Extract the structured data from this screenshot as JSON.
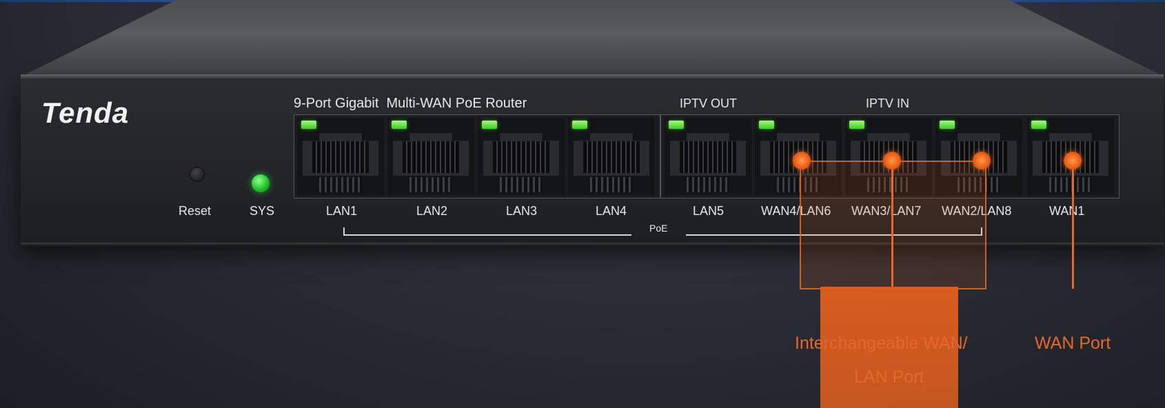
{
  "brand": "Tenda",
  "model_title": "9-Port Gigabit  Multi-WAN PoE Router",
  "group_labels": {
    "iptv_out": "IPTV OUT",
    "iptv_in": "IPTV IN"
  },
  "buttons": {
    "reset": "Reset",
    "sys": "SYS"
  },
  "ports": [
    {
      "label": "LAN1",
      "link_led": "on"
    },
    {
      "label": "LAN2",
      "link_led": "on"
    },
    {
      "label": "LAN3",
      "link_led": "on"
    },
    {
      "label": "LAN4",
      "link_led": "on"
    },
    {
      "label": "LAN5",
      "link_led": "on"
    },
    {
      "label": "WAN4/LAN6",
      "link_led": "on"
    },
    {
      "label": "WAN3/LAN7",
      "link_led": "on"
    },
    {
      "label": "WAN2/LAN8",
      "link_led": "on"
    },
    {
      "label": "WAN1",
      "link_led": "on"
    }
  ],
  "poe_label": "PoE",
  "annotations": {
    "interchangeable": [
      "Interchangeable WAN/",
      "LAN Port"
    ],
    "wan": "WAN Port"
  },
  "colors": {
    "accent_orange": "#e8672a",
    "led_green": "#46c72b",
    "body": "#232427"
  }
}
